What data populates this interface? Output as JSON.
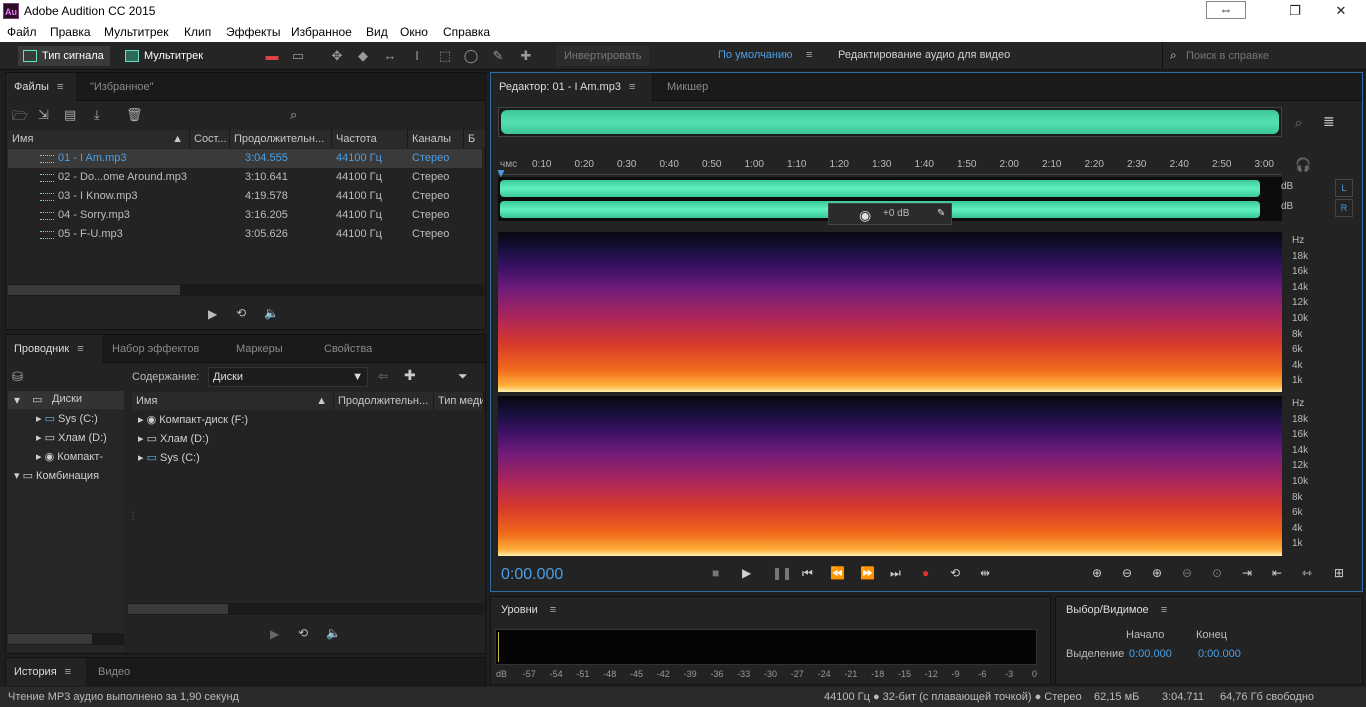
{
  "window": {
    "title": "Adobe Audition CC 2015",
    "app_icon_text": "Au"
  },
  "menu": [
    "Файл",
    "Правка",
    "Мультитрек",
    "Клип",
    "Эффекты",
    "Избранное",
    "Вид",
    "Окно",
    "Справка"
  ],
  "toolbar": {
    "waveform_label": "Тип сигнала",
    "multitrack_label": "Мультитрек",
    "invert_label": "Инвертировать",
    "workspace_default": "По умолчанию",
    "workspace_edit": "Редактирование аудио для видео",
    "help_search_placeholder": "Поиск в справке"
  },
  "files_panel": {
    "tab_files": "Файлы",
    "tab_favorites": "\"Избранное\"",
    "columns": [
      "Имя",
      "Сост...",
      "Продолжительн...",
      "Частота",
      "Каналы",
      "Б"
    ],
    "rows": [
      {
        "name": "01 - I Am.mp3",
        "duration": "3:04.555",
        "rate": "44100 Гц",
        "channels": "Стерео",
        "selected": true
      },
      {
        "name": "02 - Do...ome Around.mp3",
        "duration": "3:10.641",
        "rate": "44100 Гц",
        "channels": "Стерео"
      },
      {
        "name": "03 - I Know.mp3",
        "duration": "4:19.578",
        "rate": "44100 Гц",
        "channels": "Стерео"
      },
      {
        "name": "04 - Sorry.mp3",
        "duration": "3:16.205",
        "rate": "44100 Гц",
        "channels": "Стерео"
      },
      {
        "name": "05 - F-U.mp3",
        "duration": "3:05.626",
        "rate": "44100 Гц",
        "channels": "Стерео"
      }
    ]
  },
  "explorer_panel": {
    "tabs": [
      "Проводник",
      "Набор эффектов",
      "Маркеры",
      "Свойства"
    ],
    "content_label": "Содержание:",
    "content_value": "Диски",
    "tree": [
      "Диски",
      "Sys (C:)",
      "Хлам (D:)",
      "Компакт-",
      "Комбинация"
    ],
    "columns": [
      "Имя",
      "Продолжительн...",
      "Тип меди"
    ],
    "items": [
      "Компакт-диск (F:)",
      "Хлам (D:)",
      "Sys (C:)"
    ]
  },
  "history_panel": {
    "tabs": [
      "История",
      "Видео"
    ]
  },
  "editor": {
    "tab_editor": "Редактор: 01 - I Am.mp3",
    "tab_mixer": "Микшер",
    "ruler_unit": "чмс",
    "ruler_ticks": [
      "0:10",
      "0:20",
      "0:30",
      "0:40",
      "0:50",
      "1:00",
      "1:10",
      "1:20",
      "1:30",
      "1:40",
      "1:50",
      "2:00",
      "2:10",
      "2:20",
      "2:30",
      "2:40",
      "2:50",
      "3:00"
    ],
    "db_label": "dB",
    "channel_l": "L",
    "channel_r": "R",
    "volume": "+0 dB",
    "freq_labels": [
      "Hz",
      "18k",
      "16k",
      "14k",
      "12k",
      "10k",
      "8k",
      "6k",
      "4k",
      "1k"
    ],
    "current_time": "0:00.000"
  },
  "levels_panel": {
    "title": "Уровни",
    "scale": [
      "dB",
      "-57",
      "-54",
      "-51",
      "-48",
      "-45",
      "-42",
      "-39",
      "-36",
      "-33",
      "-30",
      "-27",
      "-24",
      "-21",
      "-18",
      "-15",
      "-12",
      "-9",
      "-6",
      "-3",
      "0"
    ]
  },
  "selection_panel": {
    "title": "Выбор/Видимое",
    "start_label": "Начало",
    "end_label": "Конец",
    "selection_label": "Выделение",
    "start_value": "0:00.000",
    "end_value": "0:00.000"
  },
  "status": {
    "message": "Чтение MP3 аудио выполнено за 1,90 секунд",
    "format": "44100 Гц ● 32-бит (с плавающей точкой) ● Стерео",
    "size": "62,15 мБ",
    "duration": "3:04.711",
    "free": "64,76 Гб свободно"
  }
}
